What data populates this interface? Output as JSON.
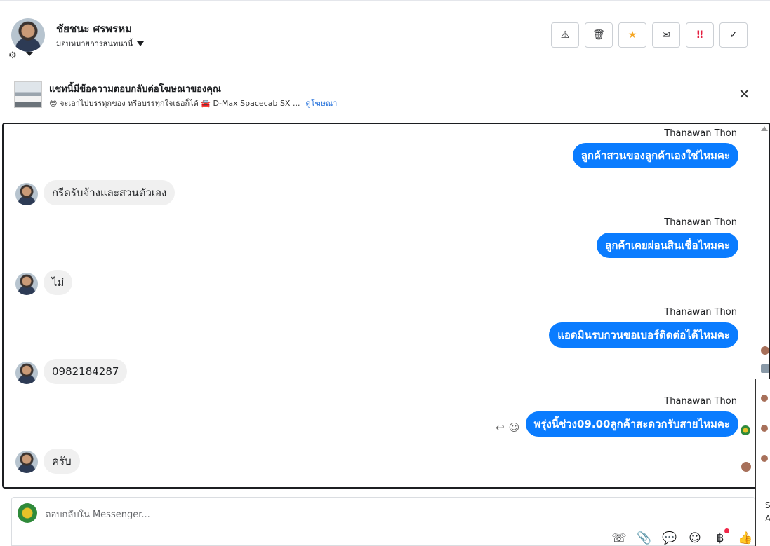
{
  "header": {
    "contact_name": "ชัยชนะ ศรพรหม",
    "assign_label": "มอบหมายการสนทนานี้",
    "actions": [
      {
        "name": "report-spam-button",
        "icon": "warning-icon",
        "glyph": "⚠"
      },
      {
        "name": "delete-button",
        "icon": "trash-icon",
        "glyph": "🗑"
      },
      {
        "name": "star-button",
        "icon": "star-icon",
        "glyph": "★"
      },
      {
        "name": "mark-unread-button",
        "icon": "envelope-open-icon",
        "glyph": "✉"
      },
      {
        "name": "follow-up-button",
        "icon": "priority-icon",
        "glyph": "‼"
      },
      {
        "name": "mark-done-button",
        "icon": "check-icon",
        "glyph": "✓"
      }
    ]
  },
  "ad": {
    "title": "แชทนี้มีข้อความตอบกลับต่อโฆษณาของคุณ",
    "subtitle": "😎 จะเอาไปบรรทุกของ หรือบรรทุกใจเธอก็ได้ 🚘 D-Max Spacecab SX ...",
    "link": "ดูโฆษณา"
  },
  "conversation": {
    "sender_name": "Thanawan Thon",
    "messages": [
      {
        "dir": "out",
        "text": "ลูกค้าสวนของลูกค้าเองใช่ไหมคะ"
      },
      {
        "dir": "in",
        "text": "กรีดรับจ้างและสวนตัวเอง"
      },
      {
        "dir": "out",
        "text": "ลูกค้าเคยผ่อนสินเชื่อไหมคะ"
      },
      {
        "dir": "in",
        "text": "ไม่"
      },
      {
        "dir": "out",
        "text": "แอดมินรบกวนขอเบอร์ติดต่อได้ไหมคะ"
      },
      {
        "dir": "in",
        "text": "0982184287"
      },
      {
        "dir": "out",
        "text": "พรุ่งนี้ช่วง09.00ลูกค้าสะดวกรับสายไหมคะ"
      },
      {
        "dir": "in",
        "text": "ครับ"
      }
    ]
  },
  "composer": {
    "placeholder": "ตอบกลับใน Messenger..."
  },
  "right_strip": {
    "letters": [
      "S",
      "A"
    ]
  },
  "colors": {
    "outgoing_bubble": "#0a7cff",
    "incoming_bubble": "#f0f0f0",
    "link": "#216fdb",
    "star": "#f5a623",
    "priority": "#e41e3f"
  }
}
